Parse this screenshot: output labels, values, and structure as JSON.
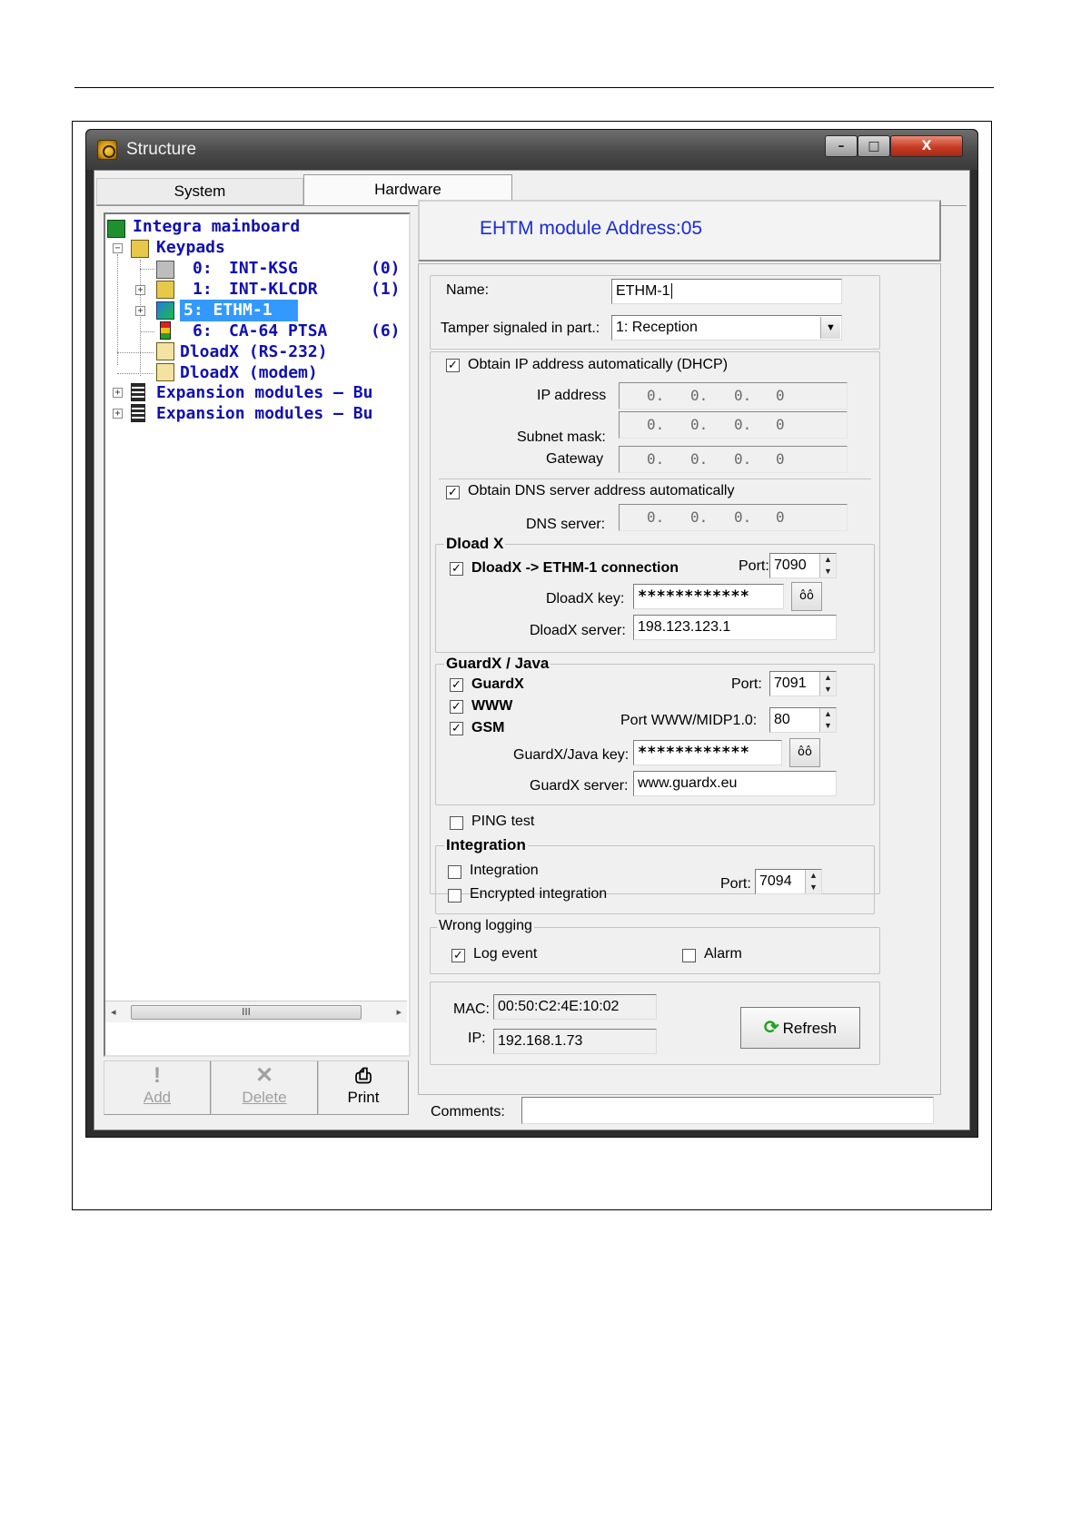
{
  "window": {
    "title": "Structure",
    "buttons": {
      "minimize": "–",
      "maximize": "□",
      "close": "X"
    }
  },
  "tabs": [
    {
      "label": "System"
    },
    {
      "label": "Hardware"
    }
  ],
  "tree": {
    "root": "Integra mainboard",
    "keypads": "Keypads",
    "items": [
      {
        "num": "0:",
        "name": "INT-KSG",
        "addr": "(0)"
      },
      {
        "num": "1:",
        "name": "INT-KLCDR",
        "addr": "(1)"
      },
      {
        "num": "5:",
        "name": "ETHM-1",
        "addr": ""
      },
      {
        "num": "6:",
        "name": "CA-64 PTSA",
        "addr": "(6)"
      }
    ],
    "dload_rs": "DloadX (RS-232)",
    "dload_modem": "DloadX (modem)",
    "expansion_1": "Expansion modules – Bu",
    "expansion_2": "Expansion modules – Bu",
    "scroll_thumb": "III"
  },
  "toolbar": {
    "add": "Add",
    "delete": "Delete",
    "print": "Print"
  },
  "module": {
    "title": "EHTM module Address:05",
    "name_label": "Name:",
    "name_value": "ETHM-1",
    "tamper_label": "Tamper signaled in part.:",
    "tamper_value": "1: Reception"
  },
  "network": {
    "dhcp_label": "Obtain IP address automatically (DHCP)",
    "ip_label": "IP address",
    "subnet_label": "Subnet mask:",
    "gateway_label": "Gateway",
    "dns_auto_label": "Obtain DNS server address automatically",
    "dns_label": "DNS server:",
    "octet": "0."
  },
  "dloadx": {
    "legend": "Dload X",
    "conn_label": "DloadX -> ETHM-1 connection",
    "port_label": "Port:",
    "port_value": "7090",
    "key_label": "DloadX key:",
    "key_value": "************",
    "server_label": "DloadX server:",
    "server_value": "198.123.123.1"
  },
  "guardx": {
    "legend": "GuardX / Java",
    "guardx_label": "GuardX",
    "www_label": "WWW",
    "gsm_label": "GSM",
    "port_label": "Port:",
    "port_value": "7091",
    "www_port_label": "Port WWW/MIDP1.0:",
    "www_port_value": "80",
    "key_label": "GuardX/Java key:",
    "key_value": "************",
    "server_label": "GuardX server:",
    "server_value": "www.guardx.eu"
  },
  "ping": {
    "label": "PING test"
  },
  "integration": {
    "legend": "Integration",
    "integration_label": "Integration",
    "encrypted_label": "Encrypted integration",
    "port_label": "Port:",
    "port_value": "7094"
  },
  "wrong_logging": {
    "legend": "Wrong logging",
    "log_event": "Log event",
    "alarm": "Alarm"
  },
  "status": {
    "mac_label": "MAC:",
    "mac_value": "00:50:C2:4E:10:02",
    "ip_label": "IP:",
    "ip_value": "192.168.1.73",
    "refresh_label": "Refresh"
  },
  "comments": {
    "label": "Comments:",
    "value": ""
  }
}
